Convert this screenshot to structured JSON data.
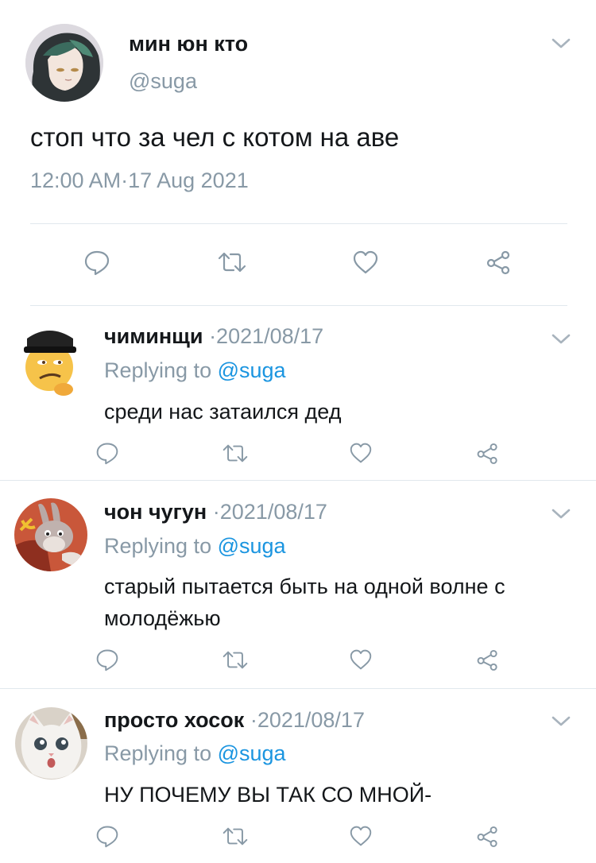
{
  "main_tweet": {
    "display_name": "мин юн кто",
    "handle": "@suga",
    "text": "стоп что за чел с котом на аве",
    "timestamp": "12:00 AM·17 Aug 2021",
    "avatar_icon": "anime-character-avatar"
  },
  "actions": {
    "reply_icon": "reply-icon",
    "retweet_icon": "retweet-icon",
    "like_icon": "like-icon",
    "share_icon": "share-icon"
  },
  "replies": [
    {
      "display_name": "чиминщи",
      "date": "·2021/08/17",
      "replying_prefix": "Replying to",
      "replying_handle": "@suga",
      "text_line1": "среди нас затаился дед",
      "text_line2": "",
      "avatar_icon": "emoji-face-with-cap-avatar"
    },
    {
      "display_name": "чон чугун",
      "date": "·2021/08/17",
      "replying_prefix": "Replying to",
      "replying_handle": "@suga",
      "text_line1": "старый пытается быть на одной волне с",
      "text_line2": "молодёжью",
      "avatar_icon": "cartoon-bunny-avatar"
    },
    {
      "display_name": "просто хосок",
      "date": "·2021/08/17",
      "replying_prefix": "Replying to",
      "replying_handle": "@suga",
      "text_line1": "НУ ПОЧЕМУ ВЫ ТАК СО МНОЙ-",
      "text_line2": "",
      "avatar_icon": "white-cat-avatar"
    }
  ],
  "colors": {
    "text": "#14171a",
    "muted": "#8899a6",
    "link": "#1b95e0",
    "separator": "#e1e8ed"
  }
}
